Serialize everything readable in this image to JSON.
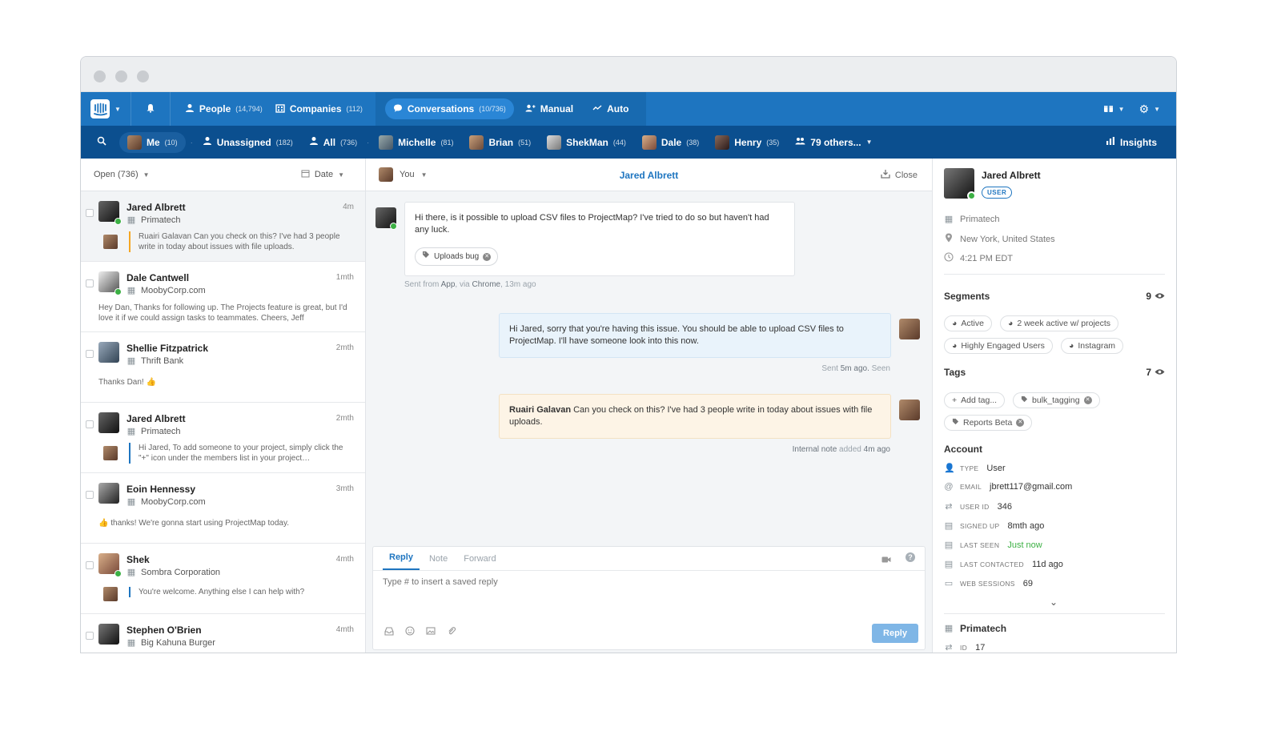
{
  "topnav": {
    "people_label": "People",
    "people_count": "(14,794)",
    "companies_label": "Companies",
    "companies_count": "(112)",
    "conversations_label": "Conversations",
    "conversations_count": "(10/736)",
    "manual_label": "Manual",
    "auto_label": "Auto"
  },
  "subnav": {
    "me_label": "Me",
    "me_count": "(10)",
    "unassigned_label": "Unassigned",
    "unassigned_count": "(182)",
    "all_label": "All",
    "all_count": "(736)",
    "teammates": [
      {
        "name": "Michelle",
        "count": "(81)"
      },
      {
        "name": "Brian",
        "count": "(51)"
      },
      {
        "name": "ShekMan",
        "count": "(44)"
      },
      {
        "name": "Dale",
        "count": "(38)"
      },
      {
        "name": "Henry",
        "count": "(35)"
      }
    ],
    "others_label": "79 others...",
    "insights_label": "Insights"
  },
  "inbox": {
    "filter_label": "Open (736)",
    "sort_label": "Date",
    "conversations": [
      {
        "name": "Jared Albrett",
        "time": "4m",
        "company": "Primatech",
        "preview": "Ruairi Galavan Can you check on this? I've had 3 people write in today about issues with file uploads.",
        "online": true
      },
      {
        "name": "Dale Cantwell",
        "time": "1mth",
        "company": "MoobyCorp.com",
        "preview": "Hey Dan, Thanks for following up. The Projects feature is great, but I'd love it if we could assign tasks to teammates. Cheers, Jeff",
        "online": true
      },
      {
        "name": "Shellie Fitzpatrick",
        "time": "2mth",
        "company": "Thrift Bank",
        "preview": "Thanks Dan! 👍",
        "online": false
      },
      {
        "name": "Jared Albrett",
        "time": "2mth",
        "company": "Primatech",
        "preview": "Hi Jared, To add someone to your project, simply click the \"+\" icon under the members list in your project…",
        "online": false
      },
      {
        "name": "Eoin Hennessy",
        "time": "3mth",
        "company": "MoobyCorp.com",
        "preview": "👍 thanks! We're gonna start using ProjectMap today.",
        "online": false
      },
      {
        "name": "Shek",
        "time": "4mth",
        "company": "Sombra Corporation",
        "preview": "You're welcome. Anything else I can help with?",
        "online": true
      },
      {
        "name": "Stephen O'Brien",
        "time": "4mth",
        "company": "Big Kahuna Burger",
        "preview": "",
        "online": false
      }
    ]
  },
  "conversation": {
    "assignee_label": "You",
    "title": "Jared Albrett",
    "close_label": "Close",
    "msg1_text": "Hi there, is it possible to upload CSV files to ProjectMap? I've tried to do so but haven't had any luck.",
    "msg1_tag": "Uploads bug",
    "msg1_meta_prefix": "Sent from",
    "msg1_meta_app": "App",
    "msg1_meta_via": ", via",
    "msg1_meta_browser": "Chrome",
    "msg1_meta_time": ", 13m ago",
    "msg2_text": "Hi Jared, sorry that you're having this issue. You should be able to upload CSV files to ProjectMap. I'll have someone look into this now.",
    "msg2_meta_prefix": "Sent",
    "msg2_meta_time": "5m ago.",
    "msg2_meta_seen": "Seen",
    "note_mention": "Ruairi Galavan",
    "note_text": " Can you check on this? I've had 3 people write in today about issues with file uploads.",
    "note_meta_a": "Internal note",
    "note_meta_b": "added",
    "note_meta_c": "4m ago"
  },
  "composer": {
    "tab_reply": "Reply",
    "tab_note": "Note",
    "tab_forward": "Forward",
    "placeholder": "Type # to insert a saved reply",
    "reply_button": "Reply"
  },
  "profile": {
    "name": "Jared Albrett",
    "badge": "USER",
    "company": "Primatech",
    "location": "New York, United States",
    "local_time": "4:21 PM EDT",
    "segments_title": "Segments",
    "segments_count": "9",
    "segments": [
      "Active",
      "2 week active w/ projects",
      "Highly Engaged Users",
      "Instagram"
    ],
    "tags_title": "Tags",
    "tags_count": "7",
    "add_tag_label": "Add tag...",
    "tags": [
      "bulk_tagging",
      "Reports Beta"
    ],
    "account_title": "Account",
    "account": [
      {
        "label": "TYPE",
        "value": "User"
      },
      {
        "label": "EMAIL",
        "value": "jbrett117@gmail.com"
      },
      {
        "label": "USER ID",
        "value": "346"
      },
      {
        "label": "SIGNED UP",
        "value": "8mth ago"
      },
      {
        "label": "LAST SEEN",
        "value": "Just now"
      },
      {
        "label": "LAST CONTACTED",
        "value": "11d ago"
      },
      {
        "label": "WEB SESSIONS",
        "value": "69"
      }
    ],
    "company_section_title": "Primatech",
    "company_id_label": "ID",
    "company_id_value": "17"
  },
  "colors": {
    "brand": "#1e75c0",
    "subnav": "#0b4f8f",
    "online": "#3cb044",
    "note": "#fdf4e6",
    "just_now": "#3cb044"
  }
}
